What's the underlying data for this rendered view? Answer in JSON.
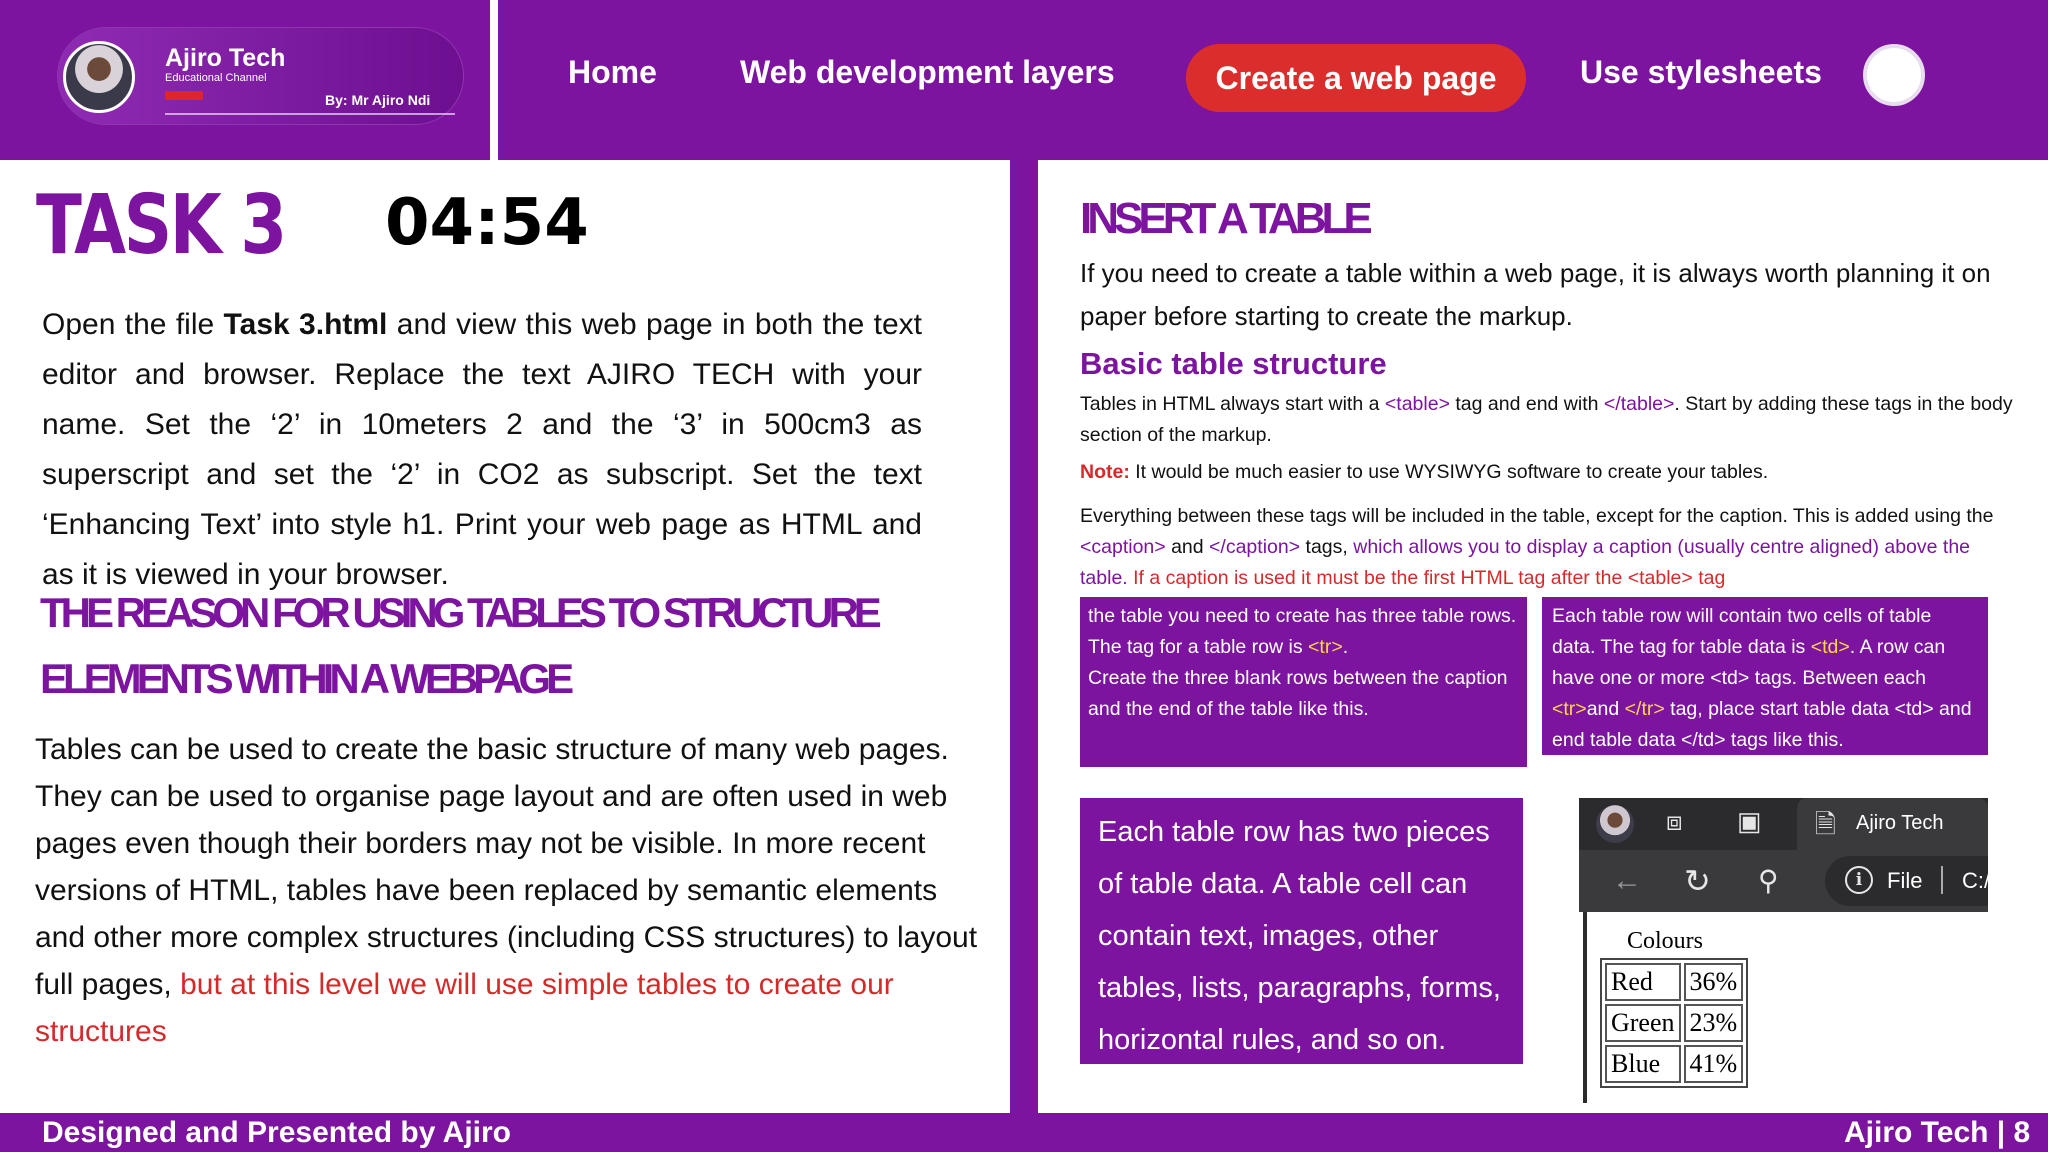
{
  "header": {
    "logo": {
      "title": "Ajiro Tech",
      "subtitle": "Educational Channel",
      "byline": "By: Mr Ajiro Ndi"
    },
    "nav": {
      "home": "Home",
      "layers": "Web development layers",
      "create": "Create a web page",
      "stylesheets": "Use stylesheets"
    }
  },
  "left": {
    "task_title": "TASK 3",
    "timer": "04:54",
    "instructions": {
      "p1": "Open the file ",
      "file": "Task 3.html",
      "p2": " and view this web page in both the text editor and browser. Replace the text AJIRO TECH with your name. Set the ‘2’ in 10meters 2 and the ‘3’ in 500cm3 as superscript and set the ‘2’ in CO2 as subscript. Set the text ‘Enhancing Text’ into style h1. Print your web page as HTML and as it is viewed in your browser."
    },
    "reason_heading": "THE REASON FOR USING TABLES TO STRUCTURE ELEMENTS WITHIN A WEBPAGE",
    "tables_paragraph": {
      "main": "Tables can be used to create the basic structure of many web pages. They can be used to organise page layout and are often used in web pages even though their borders may not be visible. In more recent versions of HTML, tables have been replaced by semantic elements and other more complex structures (including CSS structures) to layout full pages, ",
      "highlight": "but at this level we will use simple tables to create our structures"
    }
  },
  "right": {
    "insert_heading": "INSERT A TABLE",
    "insert_intro": "If you need to create a table within a web page, it is always worth planning it on paper before starting to create the markup.",
    "basic_heading": "Basic table structure",
    "basic_text": {
      "a": "Tables in HTML always start with a ",
      "tag_open": "<table>",
      "b": " tag and end with ",
      "tag_close": "</table>",
      "c": ". Start by adding these tags in the body section of the markup."
    },
    "note": {
      "label": "Note:",
      "text": " It would be much easier to use WYSIWYG software to create your tables."
    },
    "caption_text": {
      "a": "Everything between these tags will be included in the table, except for the caption. This is added using the ",
      "caption_open": "<caption>",
      "b": " and ",
      "caption_close": "</caption>",
      "c": " tags, ",
      "purple": "which allows you to display a caption (usually centre aligned) above the table",
      "d": ". ",
      "red": "If a caption is used it must be the first HTML tag after the <table> tag"
    },
    "box_rows": {
      "a": "the table you need to create has three table rows. The tag for a table row is ",
      "tr": "<tr>",
      "b": ".",
      "c": "Create the three blank rows between the caption and the end of the table like this."
    },
    "box_cells": {
      "a": "Each table row will contain two cells of table data. The tag for table data is ",
      "td": "<td>",
      "b": ". A row can have one or more <td> tags. Between each ",
      "tr_open": "<tr>",
      "c": "and ",
      "tr_close": "</tr>",
      "d": " tag, place start table data <td> and end table data </td> tags like this."
    },
    "box_pieces": "Each table row has two pieces of table data. A table cell can contain text, images, other tables, lists, paragraphs, forms, horizontal rules, and so on.",
    "browser": {
      "tab_title": "Ajiro Tech",
      "address_label": "File",
      "address_path": "C:/",
      "icons": [
        "avatar",
        "tabs-icon",
        "sidebar-icon",
        "page-icon",
        "back-icon",
        "refresh-icon",
        "search-icon",
        "info-icon"
      ]
    },
    "demo_table": {
      "caption": "Colours",
      "rows": [
        [
          "Red",
          "36%"
        ],
        [
          "Green",
          "23%"
        ],
        [
          "Blue",
          "41%"
        ]
      ]
    }
  },
  "footer": {
    "left": "Designed and Presented by Ajiro",
    "right": "Ajiro Tech | 8"
  },
  "colors": {
    "brand_purple": "#7c14a0",
    "accent_red": "#dc2d2d",
    "highlight_yellow": "#ffd54a"
  }
}
